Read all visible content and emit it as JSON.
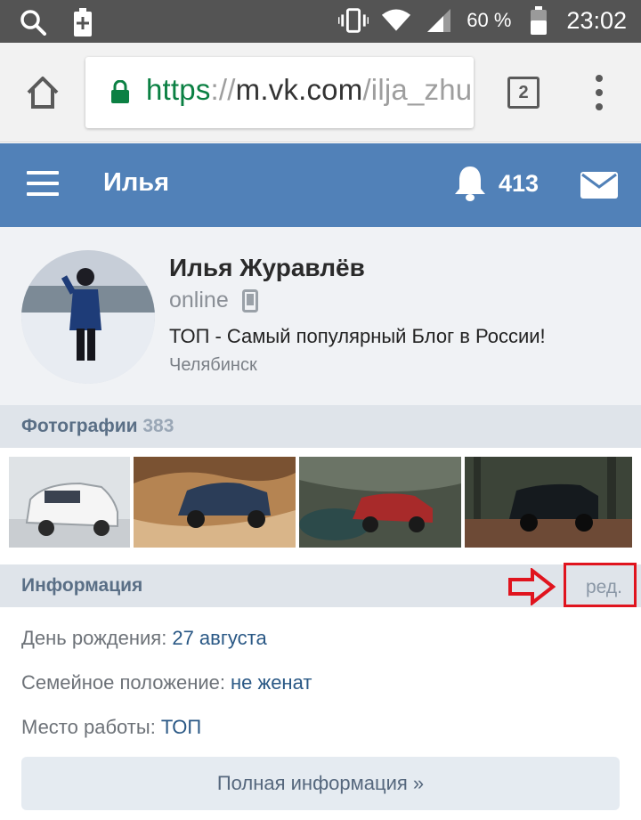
{
  "status_bar": {
    "battery": "60 %",
    "time": "23:02"
  },
  "browser": {
    "url_scheme": "https",
    "url_sep": "://",
    "url_host": "m.vk.com",
    "url_path": "/ilja_zhu",
    "tab_count": "2"
  },
  "header": {
    "title": "Илья",
    "notifications_count": "413"
  },
  "profile": {
    "name": "Илья Журавлёв",
    "online": "online",
    "status": "ТОП - Самый популярный Блог в России!",
    "city": "Челябинск"
  },
  "photos": {
    "label": "Фотографии",
    "count": "383"
  },
  "info": {
    "label": "Информация",
    "edit_label": "ред.",
    "rows": [
      {
        "label": "День рождения:",
        "value": "27 августа"
      },
      {
        "label": "Семейное положение:",
        "value": "не женат"
      },
      {
        "label": "Место работы:",
        "value": "ТОП"
      }
    ],
    "full_button": "Полная информация »"
  },
  "colors": {
    "vk_blue": "#5181b8",
    "highlight_red": "#e0141e",
    "link_blue": "#2a5885"
  }
}
